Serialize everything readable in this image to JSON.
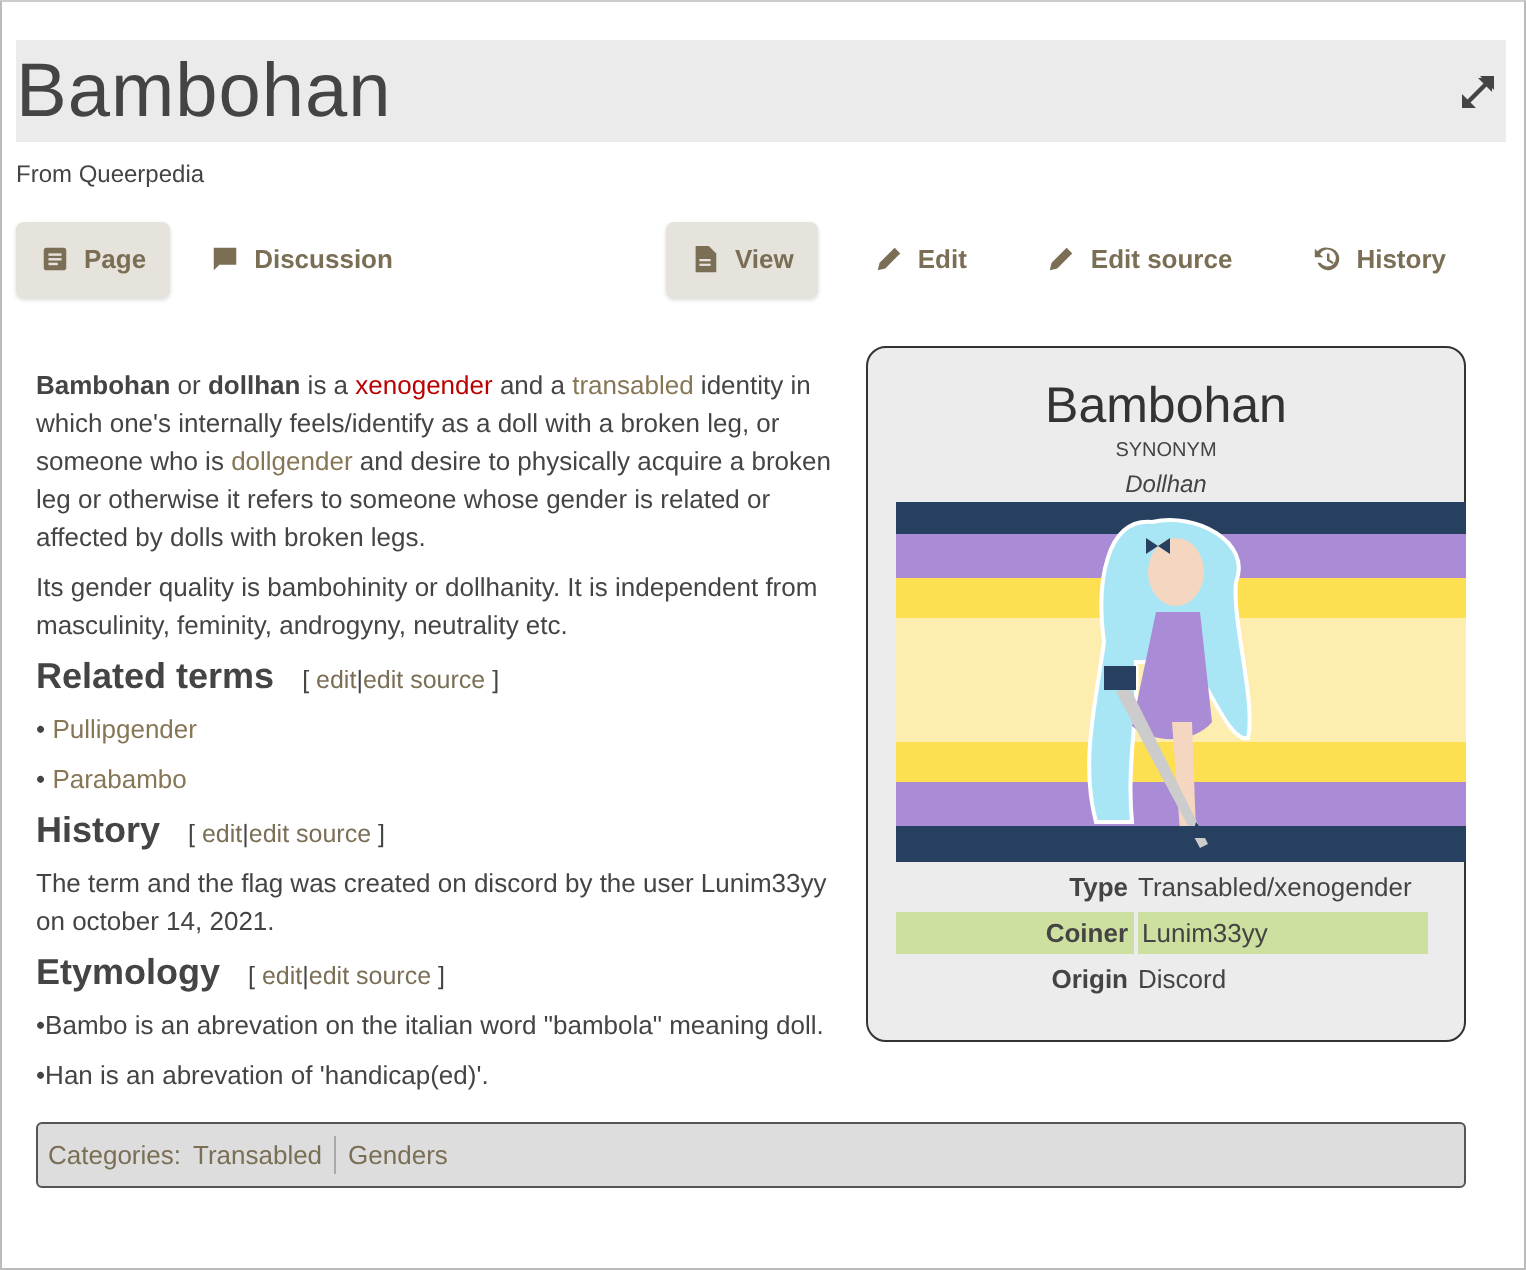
{
  "title": "Bambohan",
  "subtitle": "From Queerpedia",
  "tabs_left": [
    {
      "label": "Page",
      "selected": true
    },
    {
      "label": "Discussion",
      "selected": false
    }
  ],
  "tabs_right": [
    {
      "label": "View",
      "selected": true
    },
    {
      "label": "Edit",
      "selected": false
    },
    {
      "label": "Edit source",
      "selected": false
    },
    {
      "label": "History",
      "selected": false
    }
  ],
  "intro": [
    [
      {
        "kind": "bold",
        "text": "Bambohan"
      },
      {
        "kind": "plain",
        "text": " or "
      },
      {
        "kind": "bold",
        "text": "dollhan"
      },
      {
        "kind": "plain",
        "text": " is a "
      },
      {
        "kind": "redlink",
        "text": "xenogender"
      },
      {
        "kind": "plain",
        "text": " and a "
      },
      {
        "kind": "link",
        "text": "transabled"
      },
      {
        "kind": "plain",
        "text": " identity in which one's internally feels/identify as a doll with a broken leg, or someone who is "
      },
      {
        "kind": "link",
        "text": "dollgender"
      },
      {
        "kind": "plain",
        "text": " and desire to physically acquire a broken leg or otherwise it refers to someone whose gender is related or affected by dolls with broken legs."
      }
    ],
    [
      {
        "kind": "plain",
        "text": "Its gender quality is bambohinity or dollhanity. It is independent from masculinity, feminity, androgyny, neutrality etc."
      }
    ]
  ],
  "sections": [
    {
      "heading": "Related terms",
      "open": "[",
      "edit": "edit",
      "sep": "|",
      "edit_source": "edit source",
      "close": "]",
      "bullets": [
        {
          "marker": "•",
          "kind": "link",
          "text": "Pullipgender"
        },
        {
          "marker": "•",
          "kind": "link",
          "text": "Parabambo"
        }
      ]
    },
    {
      "heading": "History",
      "open": "[",
      "edit": "edit",
      "sep": "|",
      "edit_source": "edit source",
      "close": "]",
      "paragraphs": [
        "The term and the flag was created on discord by the user Lunim33yy on october 14, 2021."
      ]
    },
    {
      "heading": "Etymology",
      "open": "[",
      "edit": "edit",
      "sep": "|",
      "edit_source": "edit source",
      "close": "]",
      "paragraphs": [
        "•Bambo is an abrevation on the italian word \"bambola\" meaning doll.",
        "•Han is an abrevation of 'handicap(ed)'."
      ]
    }
  ],
  "infobox": {
    "title": "Bambohan",
    "synonym_label": "SYNONYM",
    "synonym": "Dollhan",
    "flag_stripes": [
      {
        "color": "#27405f"
      },
      {
        "color": "#a98bd6"
      },
      {
        "color": "#fddf52"
      },
      {
        "color": "#fdeeb0"
      },
      {
        "color": "#fddf52"
      },
      {
        "color": "#a98bd6"
      },
      {
        "color": "#27405f"
      }
    ],
    "rows": [
      {
        "label": "Type",
        "value": "Transabled/xenogender",
        "highlighted": false
      },
      {
        "label": "Coiner",
        "value": "Lunim33yy",
        "highlighted": true
      },
      {
        "label": "Origin",
        "value": "Discord",
        "highlighted": false
      }
    ]
  },
  "categories": {
    "label": "Categories:",
    "items": [
      "Transabled",
      "Genders"
    ]
  }
}
